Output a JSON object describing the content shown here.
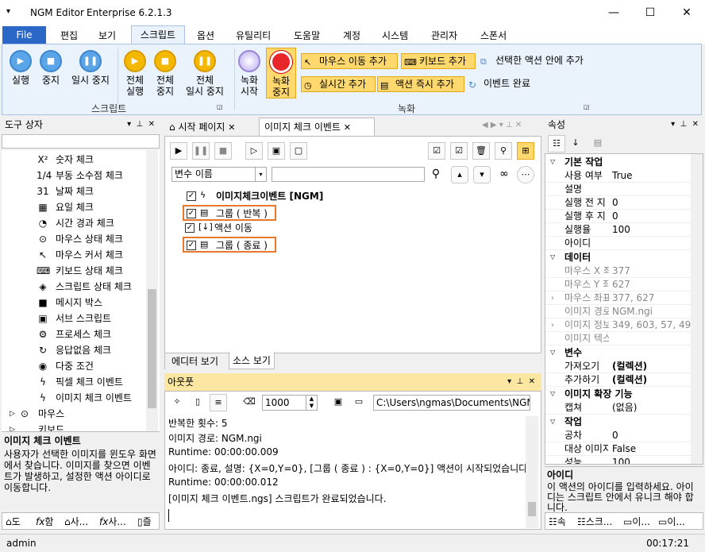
{
  "window": {
    "title": "NGM Editor",
    "edition": "Enterprise 6.2.1.3"
  },
  "ribbon_tabs": [
    "File",
    "편집",
    "보기",
    "스크립트",
    "옵션",
    "유틸리티",
    "도움말",
    "계정",
    "시스템",
    "관리자",
    "스폰서"
  ],
  "ribbon": {
    "run": "실행",
    "stop": "중지",
    "pause": "일시 중지",
    "run_all_1": "전체",
    "run_all_2": "실행",
    "stop_all_1": "전체",
    "stop_all_2": "중지",
    "pause_all_1": "전체",
    "pause_all_2": "일시 중지",
    "rec_start_1": "녹화",
    "rec_start_2": "시작",
    "rec_stop_1": "녹화",
    "rec_stop_2": "중지",
    "add_mouse_move": "마우스 이동 추가",
    "add_keyboard": "키보드 추가",
    "add_realtime": "실시간 추가",
    "add_action_now": "액션 즉시 추가",
    "add_in_selected": "선택한 액션 안에 추가",
    "event_done": "이벤트 완료",
    "group_script": "스크립트",
    "group_record": "녹화"
  },
  "toolbox": {
    "title": "도구 상자",
    "items": [
      {
        "icon": "X²",
        "label": "숫자 체크"
      },
      {
        "icon": "1/4",
        "label": "부동 소수점 체크"
      },
      {
        "icon": "31",
        "label": "날짜 체크"
      },
      {
        "icon": "▦",
        "label": "요일 체크"
      },
      {
        "icon": "◔",
        "label": "시간 경과 체크"
      },
      {
        "icon": "⊙",
        "label": "마우스 상태 체크"
      },
      {
        "icon": "↖",
        "label": "마우스 커서 체크"
      },
      {
        "icon": "⌨",
        "label": "키보드 상태 체크"
      },
      {
        "icon": "◈",
        "label": "스크립트 상태 체크"
      },
      {
        "icon": "■",
        "label": "메시지 박스"
      },
      {
        "icon": "▣",
        "label": "서브 스크립트"
      },
      {
        "icon": "⚙",
        "label": "프로세스 체크"
      },
      {
        "icon": "↻",
        "label": "응답없음 체크"
      },
      {
        "icon": "◉",
        "label": "다중 조건"
      },
      {
        "icon": "ϟ",
        "label": "픽셀 체크 이벤트"
      },
      {
        "icon": "ϟ",
        "label": "이미지 체크 이벤트"
      }
    ],
    "category": "마우스",
    "category_next": "키보드",
    "desc_title": "이미지 체크 이벤트",
    "desc_text": "사용자가 선택한 이미지를 윈도우 화면에서 찾습니다. 이미지를 찾으면 이벤트가 발생하고, 설정한 액션 아이디로 이동합니다.",
    "bottom_tabs": [
      "도",
      "함",
      "사...",
      "사...",
      "즐"
    ]
  },
  "doc_tabs": {
    "start": "시작 페이지",
    "current": "이미지 체크 이벤트"
  },
  "editor": {
    "var_select": "변수 이름",
    "tree": [
      {
        "label": "이미지체크이벤트 [NGM]",
        "bold": true,
        "icon": "ϟ"
      },
      {
        "label": "그룹 ( 반복 )",
        "bold": false,
        "icon": "▤",
        "boxed": true
      },
      {
        "label": "액션 이동",
        "bold": false,
        "icon": "[↓]"
      },
      {
        "label": "그룹 ( 종료 )",
        "bold": false,
        "icon": "▤",
        "boxed": true
      }
    ],
    "tab_editor": "에디터 보기",
    "tab_source": "소스 보기"
  },
  "output": {
    "title": "아웃풋",
    "delay": "1000",
    "path": "C:\\Users\\ngmas\\Documents\\NGM6\\",
    "lines": [
      "반복한 횟수: 5",
      "이미지 경로: NGM.ngi",
      "Runtime: 00:00:00.009",
      "아이디: 종료, 설명: {X=0,Y=0}, [그룹 ( 종료 ) : {X=0,Y=0}] 액션이 시작되었습니다.",
      "Runtime: 00:00:00.012",
      "[이미지 체크 이벤트.ngs] 스크립트가 완료되었습니다."
    ]
  },
  "properties": {
    "title": "속성",
    "cats": {
      "basic": "기본 작업",
      "data": "데이터",
      "var": "변수",
      "img": "이미지 확장 기능",
      "job": "작업"
    },
    "basic": [
      {
        "k": "사용 여부",
        "v": "True"
      },
      {
        "k": "설명",
        "v": ""
      },
      {
        "k": "실행 전 지",
        "v": "0"
      },
      {
        "k": "실행 후 지",
        "v": "0"
      },
      {
        "k": "실행율",
        "v": "100"
      },
      {
        "k": "아이디",
        "v": ""
      }
    ],
    "data": [
      {
        "k": "마우스 X 좌",
        "v": "377"
      },
      {
        "k": "마우스 Y 좌",
        "v": "627"
      },
      {
        "k": "마우스 좌표",
        "v": "377, 627"
      },
      {
        "k": "이미지 경로",
        "v": "NGM.ngi"
      },
      {
        "k": "이미지 정보",
        "v": "349, 603, 57, 49"
      },
      {
        "k": "이미지 텍스",
        "v": ""
      }
    ],
    "var": [
      {
        "k": "가져오기",
        "v": "(컬렉션)"
      },
      {
        "k": "추가하기",
        "v": "(컬렉션)"
      }
    ],
    "img": [
      {
        "k": "캡쳐",
        "v": "(없음)"
      }
    ],
    "job": [
      {
        "k": "공차",
        "v": "0"
      },
      {
        "k": "대상 이미지",
        "v": "False"
      },
      {
        "k": "성능",
        "v": "100"
      }
    ],
    "desc_title": "아이디",
    "desc_text": "이 액션의 아이디를 입력하세요. 아이디는 스크립트 안에서 유니크 해야 합니다.",
    "bottom_tabs": [
      "속",
      "스크...",
      "이...",
      "이..."
    ]
  },
  "status": {
    "user": "admin",
    "time": "00:17:21"
  }
}
